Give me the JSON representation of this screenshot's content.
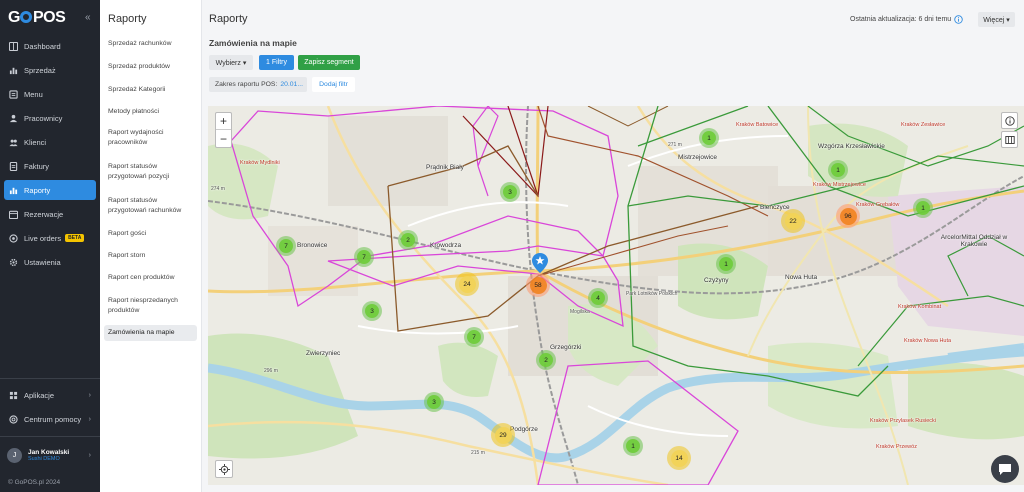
{
  "app": {
    "logo": "GOPOS",
    "copyright": "© GoPOS.pl 2024"
  },
  "sidebar": {
    "items": [
      {
        "label": "Dashboard",
        "icon": "dashboard-icon"
      },
      {
        "label": "Sprzedaż",
        "icon": "chart-icon"
      },
      {
        "label": "Menu",
        "icon": "menu-icon"
      },
      {
        "label": "Pracownicy",
        "icon": "employees-icon"
      },
      {
        "label": "Klienci",
        "icon": "clients-icon"
      },
      {
        "label": "Faktury",
        "icon": "invoice-icon"
      },
      {
        "label": "Raporty",
        "icon": "reports-icon",
        "active": true
      },
      {
        "label": "Rezerwacje",
        "icon": "calendar-icon"
      },
      {
        "label": "Live orders",
        "icon": "live-icon",
        "badge": "BETA"
      },
      {
        "label": "Ustawienia",
        "icon": "settings-icon"
      }
    ],
    "bottom": [
      {
        "label": "Aplikacje",
        "icon": "apps-icon"
      },
      {
        "label": "Centrum pomocy",
        "icon": "help-icon"
      }
    ],
    "user": {
      "initial": "J",
      "name": "Jan Kowalski",
      "subtitle": "Sushi DEMO"
    }
  },
  "submenu": {
    "title": "Raporty",
    "items": [
      "Sprzedaż rachunków",
      "Sprzedaż produktów",
      "Sprzedaż Kategorii",
      "Metody płatności",
      "Raport wydajności pracowników",
      "Raport statusów przygotowań pozycji",
      "Raport statusów przygotowań rachunków",
      "Raport gości",
      "Raport storn",
      "Raport cen produktów",
      "Raport niesprzedanych produktów",
      "Zamówienia na mapie"
    ],
    "active_index": 11
  },
  "header": {
    "title": "Raporty",
    "last_update": "Ostatnia aktualizacja: 6 dni temu",
    "more_label": "Więcej ▾"
  },
  "section": {
    "title": "Zamówienia na mapie",
    "choose_label": "Wybierz ▾",
    "filters_label": "1 Filtry",
    "save_segment_label": "Zapisz segment",
    "range_label": "Zakres raportu POS:",
    "range_value": "20.01...",
    "add_filter_label": "Dodaj filtr"
  },
  "map": {
    "zoom_in": "+",
    "zoom_out": "−",
    "clusters": [
      {
        "count": "1",
        "level": "green"
      },
      {
        "count": "1",
        "level": "green"
      },
      {
        "count": "3",
        "level": "green"
      },
      {
        "count": "22",
        "level": "yellow"
      },
      {
        "count": "96",
        "level": "orange"
      },
      {
        "count": "1",
        "level": "green"
      },
      {
        "count": "7",
        "level": "green"
      },
      {
        "count": "2",
        "level": "green"
      },
      {
        "count": "7",
        "level": "green"
      },
      {
        "count": "1",
        "level": "green"
      },
      {
        "count": "24",
        "level": "yellow"
      },
      {
        "count": "58",
        "level": "orange"
      },
      {
        "count": "4",
        "level": "green"
      },
      {
        "count": "3",
        "level": "green"
      },
      {
        "count": "7",
        "level": "green"
      },
      {
        "count": "2",
        "level": "green"
      },
      {
        "count": "3",
        "level": "green"
      },
      {
        "count": "29",
        "level": "yellow"
      },
      {
        "count": "1",
        "level": "green"
      },
      {
        "count": "14",
        "level": "yellow"
      }
    ],
    "labels": [
      "Mistrzejowice",
      "Wzgórza Krzesławickie",
      "Krowodrza",
      "Bieńczyce",
      "Bronowice",
      "Czyżyny",
      "Nowa Huta",
      "Zwierzyniec",
      "Grzegórzki",
      "Podgórze",
      "ArcelorMittal Oddział w Krakowie",
      "Kraków Kombinat",
      "Kraków Nowa Huta",
      "Kraków Przylasek Rusiecki",
      "Kraków Przewóz",
      "Kraków Mistrzejowice",
      "Kraków Batowice",
      "Kraków Zesławice",
      "Kraków Grębałów",
      "Kraków Mydlniki",
      "Mogilska",
      "Prądnik Biały",
      "Park Lotników Polskich",
      "271 m",
      "274 m",
      "296 m",
      "215 m"
    ]
  }
}
